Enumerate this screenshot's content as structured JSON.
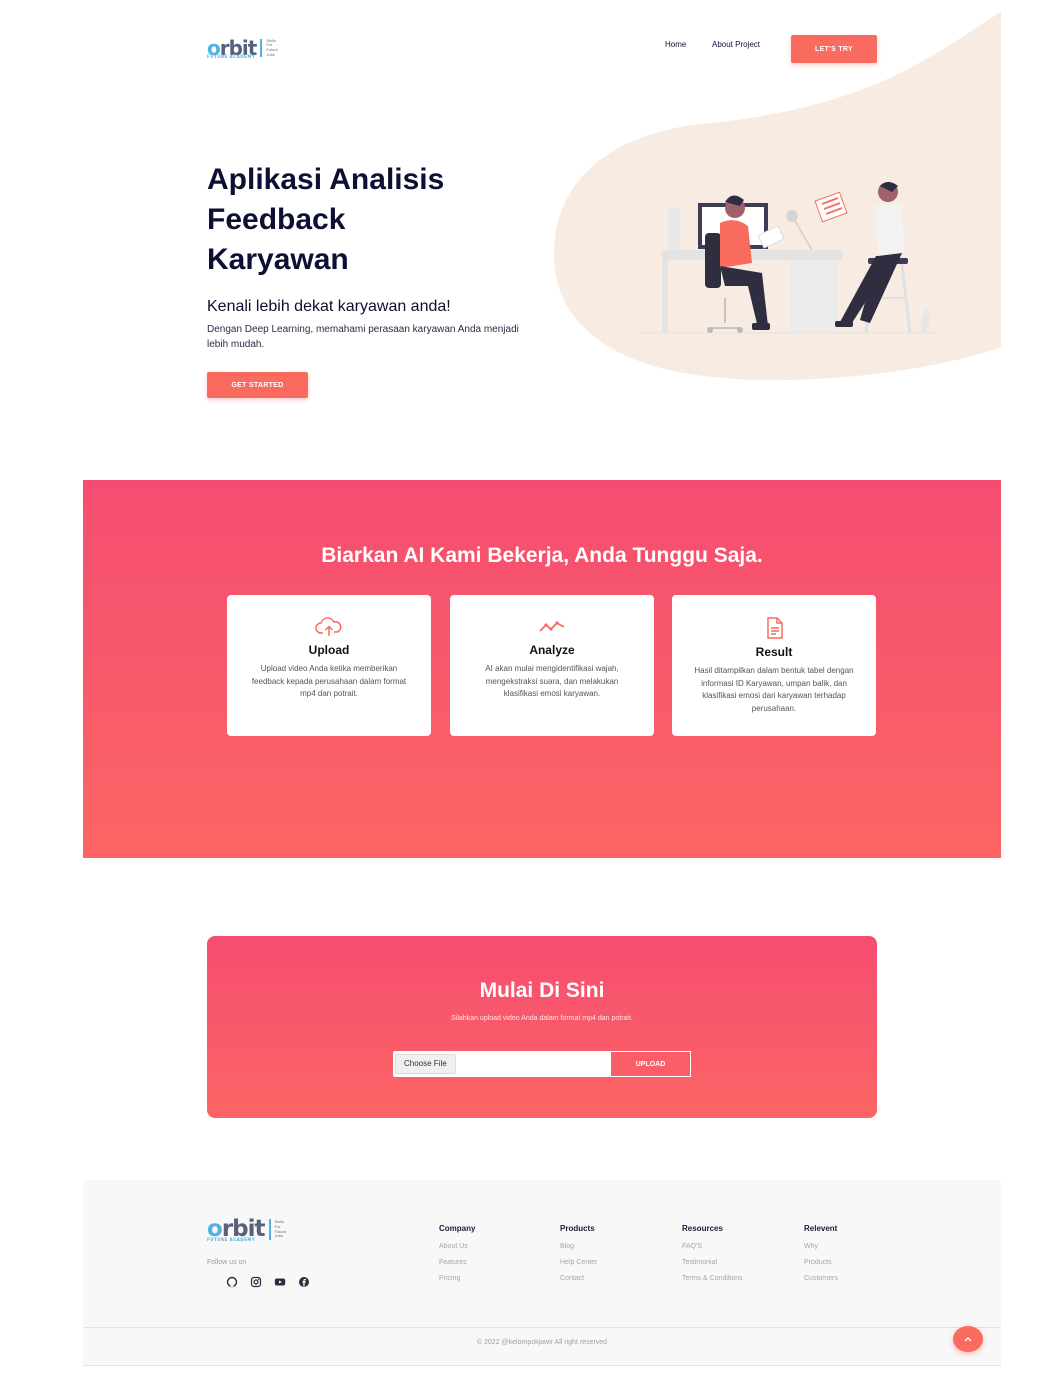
{
  "brand": {
    "wordmark_prefix": "o",
    "wordmark_rest": "rbit",
    "subtitle": "FUTURE ACADEMY",
    "tagline": [
      "Skills",
      "For",
      "Future",
      "Jobs"
    ]
  },
  "nav": {
    "home": "Home",
    "about": "About Project",
    "cta": "LET'S TRY"
  },
  "hero": {
    "title_line1": "Aplikasi Analisis",
    "title_line2": "Feedback",
    "title_line3": "Karyawan",
    "subtitle": "Kenali lebih dekat karyawan anda!",
    "description": "Dengan Deep Learning, memahami perasaan karyawan Anda menjadi lebih mudah.",
    "cta": "GET STARTED"
  },
  "features": {
    "title": "Biarkan AI Kami Bekerja, Anda Tunggu Saja.",
    "cards": [
      {
        "icon": "cloud-upload-icon",
        "title": "Upload",
        "description": "Upload video Anda ketika memberikan feedback kepada perusahaan dalam format mp4 dan potrait."
      },
      {
        "icon": "trend-line-icon",
        "title": "Analyze",
        "description": "AI akan mulai mengidentifikasi wajah, mengekstraksi suara, dan melakukan klasifikasi emosi karyawan."
      },
      {
        "icon": "document-icon",
        "title": "Result",
        "description": "Hasil ditampilkan dalam bentuk tabel dengan informasi ID Karyawan, umpan balik, dan klasifikasi emosi dari karyawan terhadap perusahaan."
      }
    ]
  },
  "upload": {
    "title": "Mulai Di Sini",
    "description": "Silahkan upload video Anda dalam format mp4 dan potrait.",
    "file_button": "Choose File",
    "submit": "UPLOAD"
  },
  "footer": {
    "follow": "Follow us on",
    "social": [
      "github-icon",
      "instagram-icon",
      "youtube-icon",
      "facebook-icon"
    ],
    "columns": [
      {
        "title": "Company",
        "items": [
          "About Us",
          "Features",
          "Pricing"
        ]
      },
      {
        "title": "Products",
        "items": [
          "Blog",
          "Help Center",
          "Contact"
        ]
      },
      {
        "title": "Resources",
        "items": [
          "FAQ'S",
          "Testimonial",
          "Terms & Conditions"
        ]
      },
      {
        "title": "Relevent",
        "items": [
          "Why",
          "Products",
          "Customers"
        ]
      }
    ],
    "copyright": "© 2022 @kelompokjawir All right reserved"
  },
  "colors": {
    "accent": "#fa6b5f",
    "gradient_top": "#f54d71",
    "gradient_bottom": "#fc6564",
    "navy": "#0d0f33",
    "logo_blue": "#4fb3e3",
    "blob": "#f7ebe2"
  }
}
